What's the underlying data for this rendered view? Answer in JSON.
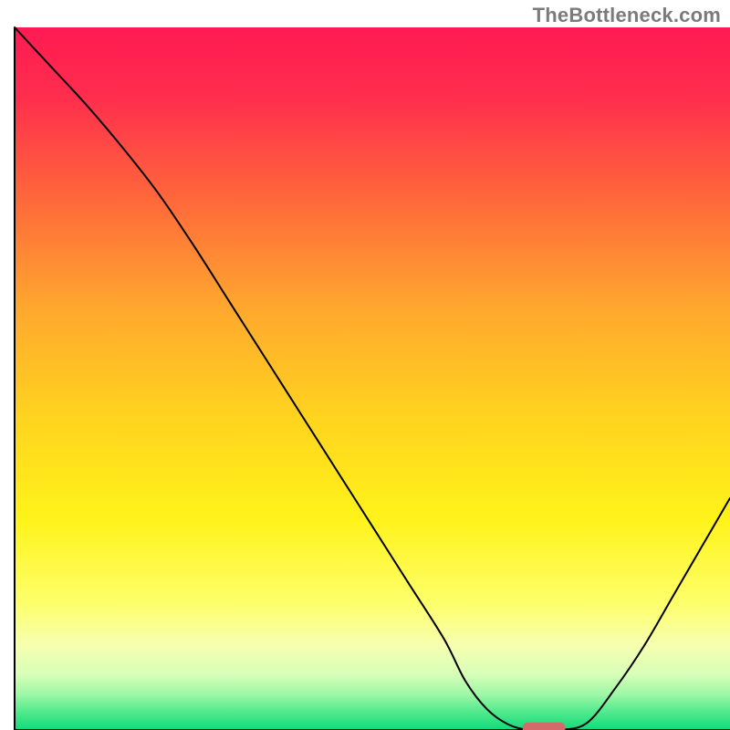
{
  "watermark": "TheBottleneck.com",
  "chart_data": {
    "type": "line",
    "title": "",
    "xlabel": "",
    "ylabel": "",
    "xlim": [
      0,
      100
    ],
    "ylim": [
      0,
      100
    ],
    "x": [
      0,
      5,
      10,
      15,
      20,
      25,
      30,
      35,
      40,
      45,
      50,
      55,
      60,
      63,
      66,
      69,
      72,
      76,
      80,
      84,
      88,
      92,
      96,
      100
    ],
    "values": [
      100,
      94.5,
      89,
      83,
      76.5,
      69,
      61,
      53,
      45,
      37,
      29,
      21,
      13,
      7,
      3,
      0.8,
      0,
      0,
      1,
      6,
      12,
      19,
      26,
      33
    ],
    "curve_notes": "Single curve starting top-left, descending roughly linearly with a slight inflection near x~25, dipping to y=0 around x~70-76, then rising toward the right edge (~33% at x=100).",
    "marker": {
      "x_center": 74,
      "y": 0.3,
      "width_pct": 6,
      "color": "#d46a6a",
      "shape": "pill"
    },
    "gradient_stops": [
      {
        "offset": 0.0,
        "color": "#ff1a52"
      },
      {
        "offset": 0.1,
        "color": "#ff2e4d"
      },
      {
        "offset": 0.25,
        "color": "#ff6a3a"
      },
      {
        "offset": 0.4,
        "color": "#ffa82e"
      },
      {
        "offset": 0.55,
        "color": "#ffd21f"
      },
      {
        "offset": 0.7,
        "color": "#fff31a"
      },
      {
        "offset": 0.82,
        "color": "#fdff6b"
      },
      {
        "offset": 0.88,
        "color": "#f6ffb0"
      },
      {
        "offset": 0.92,
        "color": "#d8ffb8"
      },
      {
        "offset": 0.95,
        "color": "#9cf7a6"
      },
      {
        "offset": 0.975,
        "color": "#4fe98c"
      },
      {
        "offset": 1.0,
        "color": "#12d97a"
      }
    ],
    "border_color": "#000000",
    "border_width_px": 2
  }
}
